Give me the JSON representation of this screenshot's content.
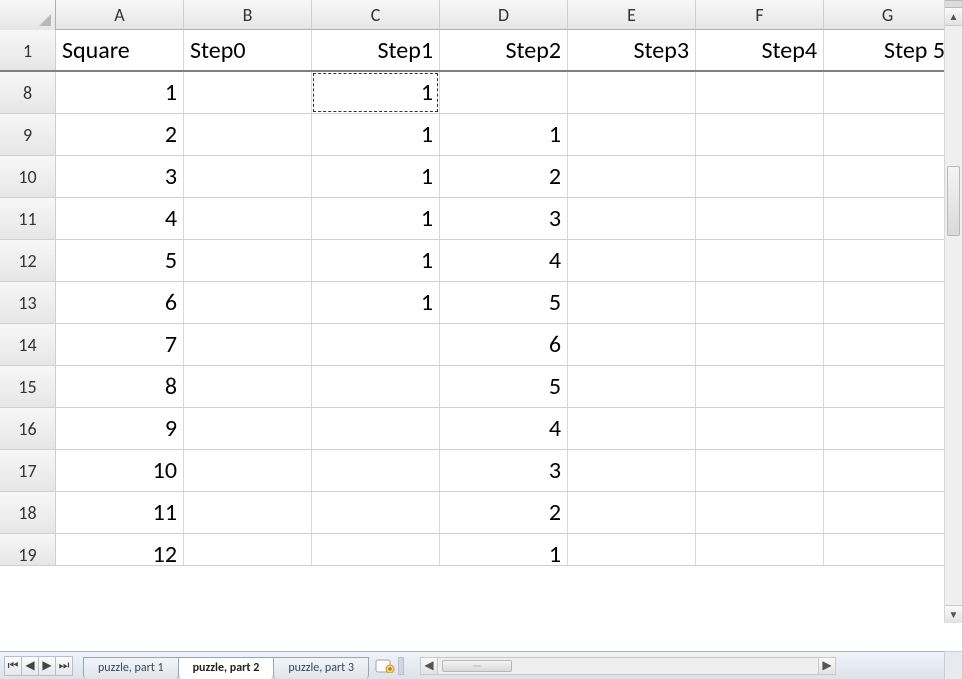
{
  "columns": [
    "A",
    "B",
    "C",
    "D",
    "E",
    "F",
    "G"
  ],
  "header_row": {
    "row_num": "1",
    "cells": [
      "Square",
      "Step0",
      "Step1",
      "Step2",
      "Step3",
      "Step4",
      "Step 5"
    ]
  },
  "rows": [
    {
      "num": "8",
      "cells": [
        "1",
        "",
        "1",
        "",
        "",
        "",
        ""
      ]
    },
    {
      "num": "9",
      "cells": [
        "2",
        "",
        "1",
        "1",
        "",
        "",
        ""
      ]
    },
    {
      "num": "10",
      "cells": [
        "3",
        "",
        "1",
        "2",
        "",
        "",
        ""
      ]
    },
    {
      "num": "11",
      "cells": [
        "4",
        "",
        "1",
        "3",
        "",
        "",
        ""
      ]
    },
    {
      "num": "12",
      "cells": [
        "5",
        "",
        "1",
        "4",
        "",
        "",
        ""
      ]
    },
    {
      "num": "13",
      "cells": [
        "6",
        "",
        "1",
        "5",
        "",
        "",
        ""
      ]
    },
    {
      "num": "14",
      "cells": [
        "7",
        "",
        "",
        "6",
        "",
        "",
        ""
      ]
    },
    {
      "num": "15",
      "cells": [
        "8",
        "",
        "",
        "5",
        "",
        "",
        ""
      ]
    },
    {
      "num": "16",
      "cells": [
        "9",
        "",
        "",
        "4",
        "",
        "",
        ""
      ]
    },
    {
      "num": "17",
      "cells": [
        "10",
        "",
        "",
        "3",
        "",
        "",
        ""
      ]
    },
    {
      "num": "18",
      "cells": [
        "11",
        "",
        "",
        "2",
        "",
        "",
        ""
      ]
    },
    {
      "num": "19",
      "cells": [
        "12",
        "",
        "",
        "1",
        "",
        "",
        ""
      ]
    }
  ],
  "marquee_cell": {
    "row": "8",
    "col": "C"
  },
  "tabs": [
    {
      "label": "puzzle, part 1",
      "active": false
    },
    {
      "label": "puzzle, part 2",
      "active": true
    },
    {
      "label": "puzzle, part 3",
      "active": false
    }
  ],
  "nav_glyphs": {
    "first": "⏮",
    "prev": "◀",
    "next": "▶",
    "last": "⏭"
  }
}
